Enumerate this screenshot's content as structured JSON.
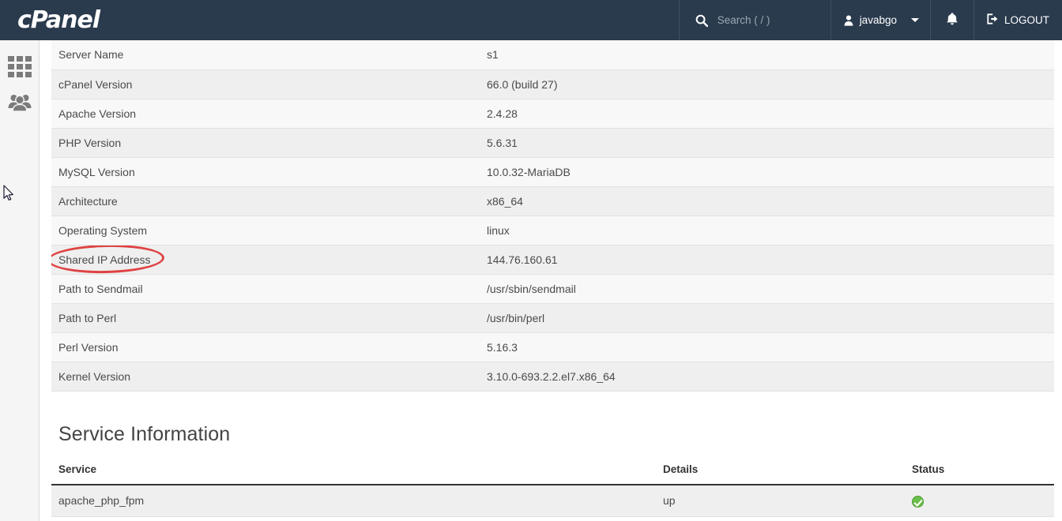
{
  "header": {
    "brand": "cPanel",
    "search": {
      "placeholder": "Search ( / )",
      "value": "",
      "icon": "search-icon"
    },
    "user": {
      "name": "javabgo",
      "icon": "user-icon",
      "caret_icon": "chevron-down-icon"
    },
    "notifications": {
      "icon": "bell-icon"
    },
    "logout": {
      "label": "LOGOUT",
      "icon": "logout-icon"
    },
    "accent_dark": "#2b3b4e"
  },
  "sidebar": {
    "items": [
      {
        "name": "apps-grid",
        "icon": "grid-icon"
      },
      {
        "name": "user-manager",
        "icon": "users-icon"
      }
    ]
  },
  "server_information": {
    "rows": [
      {
        "key": "Server Name",
        "value": "s1"
      },
      {
        "key": "cPanel Version",
        "value": "66.0 (build 27)"
      },
      {
        "key": "Apache Version",
        "value": "2.4.28"
      },
      {
        "key": "PHP Version",
        "value": "5.6.31"
      },
      {
        "key": "MySQL Version",
        "value": "10.0.32-MariaDB"
      },
      {
        "key": "Architecture",
        "value": "x86_64"
      },
      {
        "key": "Operating System",
        "value": "linux"
      },
      {
        "key": "Shared IP Address",
        "value": "144.76.160.61"
      },
      {
        "key": "Path to Sendmail",
        "value": "/usr/sbin/sendmail"
      },
      {
        "key": "Path to Perl",
        "value": "/usr/bin/perl"
      },
      {
        "key": "Perl Version",
        "value": "5.16.3"
      },
      {
        "key": "Kernel Version",
        "value": "3.10.0-693.2.2.el7.x86_64"
      }
    ]
  },
  "annotation": {
    "target": "Shared IP Address",
    "shape": "ellipse",
    "color": "#dd3333"
  },
  "service_information": {
    "title": "Service Information",
    "columns": [
      "Service",
      "Details",
      "Status"
    ],
    "rows": [
      {
        "service": "apache_php_fpm",
        "details": "up",
        "status_icon": "status-ok-icon"
      }
    ]
  }
}
